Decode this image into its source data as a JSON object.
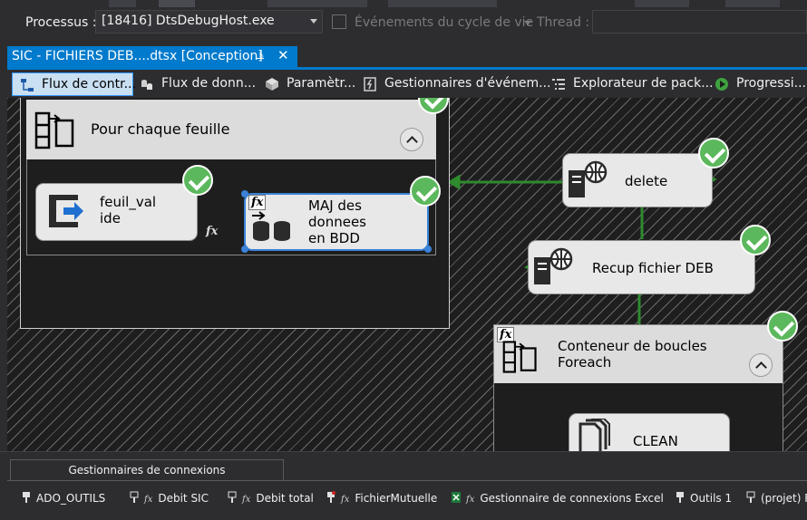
{
  "debug_bar": {
    "process_label": "Processus :",
    "process_value": "[18416] DtsDebugHost.exe",
    "lifecycle_label": "Événements du cycle de vie",
    "thread_label": "Thread :"
  },
  "document_tab": {
    "title": "SIC - FICHIERS DEB....dtsx [Conception]",
    "pin_icon": "pin-icon",
    "close_icon": "close-icon"
  },
  "designer_tabs": [
    {
      "label": "Flux de contr...",
      "icon": "control-flow-icon",
      "active": true
    },
    {
      "label": "Flux de donn...",
      "icon": "data-flow-icon",
      "active": false
    },
    {
      "label": "Paramètr...",
      "icon": "parameters-icon",
      "active": false
    },
    {
      "label": "Gestionnaires d'événem...",
      "icon": "event-handlers-icon",
      "active": false
    },
    {
      "label": "Explorateur de pack...",
      "icon": "package-explorer-icon",
      "active": false
    },
    {
      "label": "Progressi...",
      "icon": "progress-icon",
      "active": false
    }
  ],
  "canvas": {
    "container_1": {
      "title": "Pour chaque feuille",
      "status": "success"
    },
    "task_feuil": {
      "label_line1": "feuil_val",
      "label_line2": "ide",
      "status": "success"
    },
    "task_maj": {
      "label_line1": "MAJ des",
      "label_line2": "donnees",
      "label_line3": "en BDD",
      "status": "success"
    },
    "task_delete": {
      "label": "delete",
      "status": "success"
    },
    "task_recup": {
      "label": "Recup fichier DEB",
      "status": "success"
    },
    "container_2": {
      "title_line1": "Conteneur de boucles",
      "title_line2": "Foreach",
      "status": "success"
    },
    "task_clean": {
      "label": "CLEAN"
    },
    "fx_symbol": "fx",
    "colors": {
      "success": "#5cb85c",
      "connector": "#2e8b2e",
      "selection": "#3a82d8"
    }
  },
  "connections": {
    "tab_label": "Gestionnaires de connexions",
    "items": [
      {
        "label": "ADO_OUTILS",
        "fx": false
      },
      {
        "label": "Debit SIC",
        "fx": true
      },
      {
        "label": "Debit total",
        "fx": true
      },
      {
        "label": "FichierMutuelle",
        "fx": true
      },
      {
        "label": "Gestionnaire de connexions Excel",
        "fx": true
      },
      {
        "label": "Outils 1",
        "fx": false
      },
      {
        "label": "(projet) F",
        "fx": false
      }
    ]
  }
}
